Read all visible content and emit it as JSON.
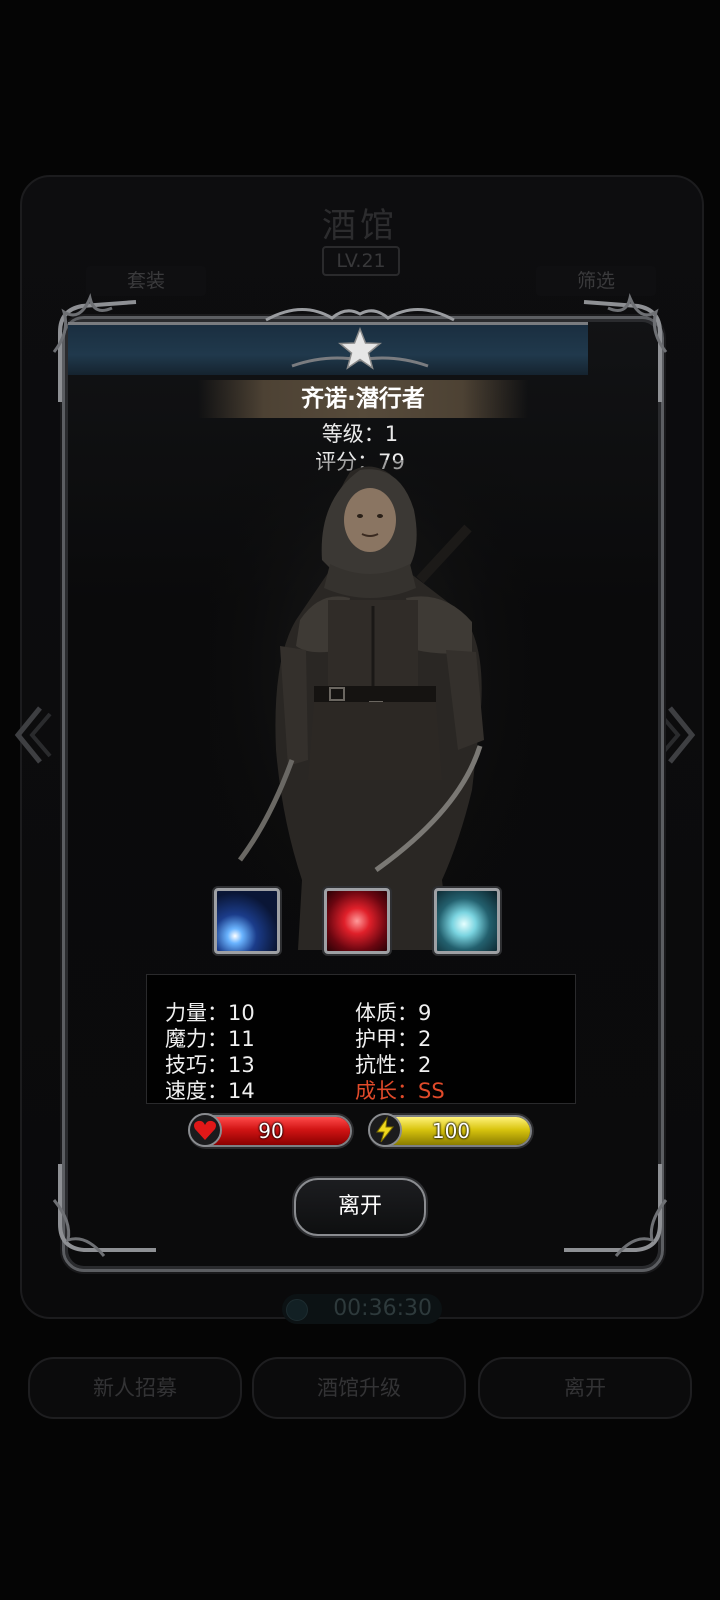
{
  "background": {
    "title": "酒馆",
    "level_badge": "LV.21",
    "tab_left": "套装",
    "tab_right": "筛选",
    "timer": "00:36:30",
    "buttons": [
      "新人招募",
      "酒馆升级",
      "离开"
    ]
  },
  "hero": {
    "name": "齐诺·潜行者",
    "level_text": "等级：1",
    "score_text": "评分：79"
  },
  "skills": [
    {
      "icon": "light-beam-skill-icon",
      "color": "#2a6adb"
    },
    {
      "icon": "red-slash-skill-icon",
      "color": "#e0202a"
    },
    {
      "icon": "wind-swirl-skill-icon",
      "color": "#7ad4e0"
    }
  ],
  "stats": {
    "strength": "力量：10",
    "constitution": "体质：9",
    "magic": "魔力：11",
    "armor": "护甲：2",
    "skill": "技巧：13",
    "resistance": "抗性：2",
    "speed": "速度：14",
    "growth": "成长：SS"
  },
  "bars": {
    "hp_value": "90",
    "hp_fraction": 1.0,
    "energy_value": "100",
    "energy_fraction": 1.0
  },
  "colors": {
    "growth": "#e04a2a",
    "hp": "#d11414",
    "energy": "#d8c40e"
  },
  "leave_label": "离开"
}
